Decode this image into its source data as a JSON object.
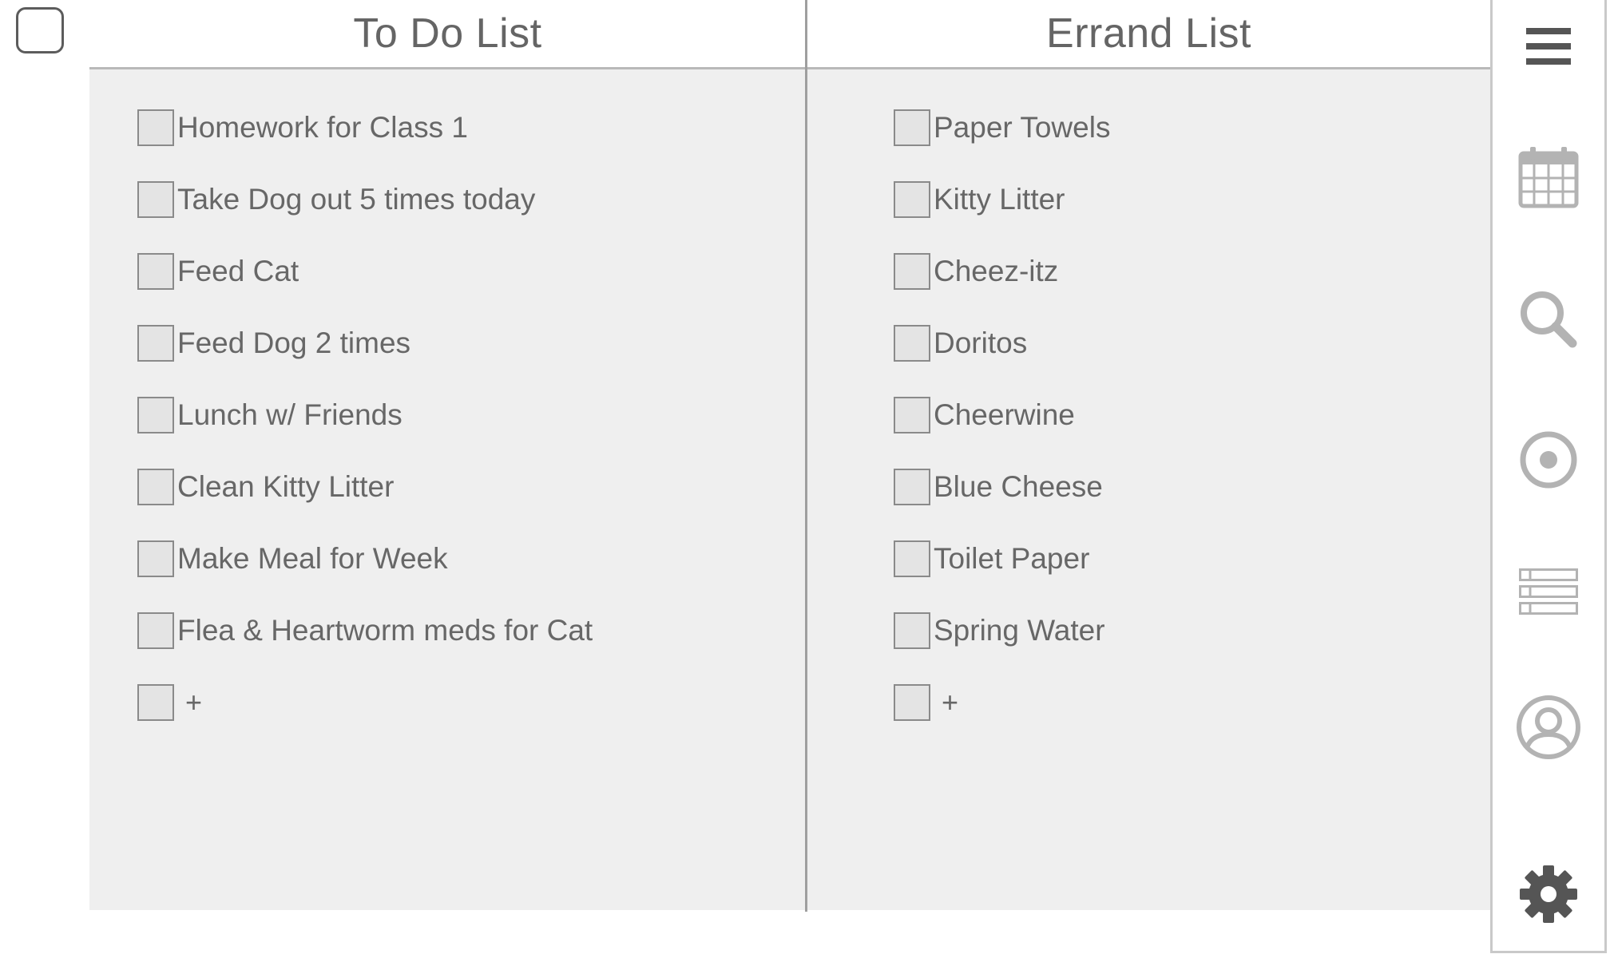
{
  "todo": {
    "title": "To Do List",
    "items": [
      {
        "label": "Homework for Class 1",
        "checked": false
      },
      {
        "label": "Take Dog out 5 times today",
        "checked": false
      },
      {
        "label": "Feed Cat",
        "checked": false
      },
      {
        "label": "Feed Dog 2 times",
        "checked": false
      },
      {
        "label": "Lunch w/ Friends",
        "checked": false
      },
      {
        "label": "Clean Kitty Litter",
        "checked": false
      },
      {
        "label": "Make Meal for Week",
        "checked": false
      },
      {
        "label": "Flea & Heartworm meds for Cat",
        "checked": false
      }
    ],
    "add_label": "+"
  },
  "errand": {
    "title": "Errand List",
    "items": [
      {
        "label": "Paper Towels",
        "checked": false
      },
      {
        "label": "Kitty Litter",
        "checked": false
      },
      {
        "label": "Cheez-itz",
        "checked": false
      },
      {
        "label": "Doritos",
        "checked": false
      },
      {
        "label": "Cheerwine",
        "checked": false
      },
      {
        "label": "Blue Cheese",
        "checked": false
      },
      {
        "label": "Toilet Paper",
        "checked": false
      },
      {
        "label": "Spring Water",
        "checked": false
      }
    ],
    "add_label": "+"
  },
  "sidebar": {
    "icons": [
      "menu-icon",
      "calendar-icon",
      "search-icon",
      "target-icon",
      "list-icon",
      "user-icon",
      "gear-icon"
    ]
  },
  "colors": {
    "text": "#676767",
    "panel": "#efefef",
    "checkbox_fill": "#e4e4e4",
    "icon_dark": "#555555",
    "icon_light": "#b3b3b3"
  }
}
